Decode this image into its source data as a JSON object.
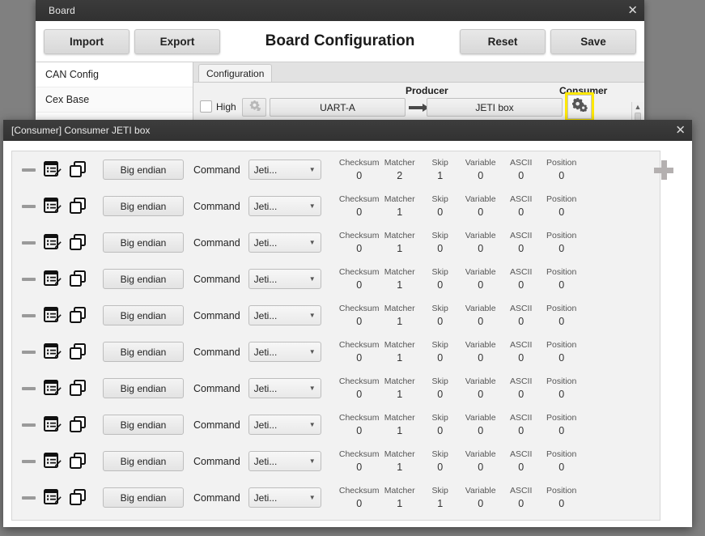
{
  "board_window": {
    "title": "Board",
    "close_icon": "close-icon",
    "toolbar": {
      "import_label": "Import",
      "export_label": "Export",
      "reset_label": "Reset",
      "save_label": "Save"
    },
    "page_title": "Board Configuration",
    "sidebar": {
      "items": [
        {
          "label": "CAN Config"
        },
        {
          "label": "Cex Base"
        }
      ]
    },
    "tabs": [
      {
        "label": "Configuration"
      }
    ],
    "pipeline": {
      "producer_label": "Producer",
      "consumer_label": "Consumer",
      "high_label": "High",
      "producer_value": "UART-A",
      "consumer_value": "JETI box",
      "arrow_icon": "arrow-right-icon",
      "producer_gear_icon": "gear-icon",
      "consumer_gear_icon": "gear-icon",
      "highlight_color": "#ffe800"
    }
  },
  "consumer_dialog": {
    "title": "[Consumer] Consumer JETI box",
    "close_icon": "close-icon",
    "add_icon": "plus-icon",
    "row_defaults": {
      "remove_icon": "minus-icon",
      "edit_icon": "edit-list-icon",
      "duplicate_icon": "duplicate-icon",
      "endian_label": "Big endian",
      "command_label": "Command",
      "command_value": "Jeti...",
      "chevron_icon": "chevron-down-icon"
    },
    "stat_keys": [
      "Checksum",
      "Matcher",
      "Skip",
      "Variable",
      "ASCII",
      "Position"
    ],
    "rows": [
      {
        "endian": "Big endian",
        "command_label": "Command",
        "command_value": "Jeti...",
        "stats": [
          0,
          2,
          1,
          0,
          0,
          0
        ]
      },
      {
        "endian": "Big endian",
        "command_label": "Command",
        "command_value": "Jeti...",
        "stats": [
          0,
          1,
          0,
          0,
          0,
          0
        ]
      },
      {
        "endian": "Big endian",
        "command_label": "Command",
        "command_value": "Jeti...",
        "stats": [
          0,
          1,
          0,
          0,
          0,
          0
        ]
      },
      {
        "endian": "Big endian",
        "command_label": "Command",
        "command_value": "Jeti...",
        "stats": [
          0,
          1,
          0,
          0,
          0,
          0
        ]
      },
      {
        "endian": "Big endian",
        "command_label": "Command",
        "command_value": "Jeti...",
        "stats": [
          0,
          1,
          0,
          0,
          0,
          0
        ]
      },
      {
        "endian": "Big endian",
        "command_label": "Command",
        "command_value": "Jeti...",
        "stats": [
          0,
          1,
          0,
          0,
          0,
          0
        ]
      },
      {
        "endian": "Big endian",
        "command_label": "Command",
        "command_value": "Jeti...",
        "stats": [
          0,
          1,
          0,
          0,
          0,
          0
        ]
      },
      {
        "endian": "Big endian",
        "command_label": "Command",
        "command_value": "Jeti...",
        "stats": [
          0,
          1,
          0,
          0,
          0,
          0
        ]
      },
      {
        "endian": "Big endian",
        "command_label": "Command",
        "command_value": "Jeti...",
        "stats": [
          0,
          1,
          0,
          0,
          0,
          0
        ]
      },
      {
        "endian": "Big endian",
        "command_label": "Command",
        "command_value": "Jeti...",
        "stats": [
          0,
          1,
          1,
          0,
          0,
          0
        ]
      }
    ]
  }
}
